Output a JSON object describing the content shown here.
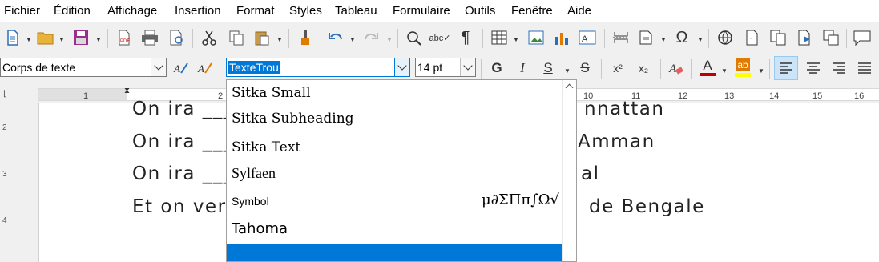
{
  "menu": [
    "Fichier",
    "Édition",
    "Affichage",
    "Insertion",
    "Format",
    "Styles",
    "Tableau",
    "Formulaire",
    "Outils",
    "Fenêtre",
    "Aide"
  ],
  "toolbar": {
    "paragraph_style": "Corps de texte",
    "font_name": "TexteTrou",
    "font_size": "14 pt",
    "bold_label": "G",
    "italic_label": "I",
    "underline_label": "S",
    "strike_label": "S",
    "superscript_label": "x²",
    "subscript_label": "x₂",
    "font_color_label": "A",
    "highlight_label": "ab",
    "font_color": "#c00000",
    "highlight_color": "#ffff00"
  },
  "ruler": {
    "numbers": [
      "1",
      "2",
      "10",
      "11",
      "12",
      "13",
      "14",
      "15",
      "16"
    ]
  },
  "vruler": {
    "numbers": [
      "2",
      "3",
      "4"
    ]
  },
  "document": {
    "lines": [
      "On ira",
      "On ira",
      "On ira",
      "Et on ver"
    ],
    "right_fragments": [
      "nnattan",
      "Amman",
      "al",
      "de Bengale"
    ]
  },
  "font_list": {
    "items": [
      "Sitka Small",
      "Sitka Subheading",
      "Sitka Text",
      "Sylfaen",
      "Symbol",
      "Tahoma"
    ],
    "symbol_preview": "μ∂ΣΠπ∫Ω√",
    "selected_color": "#0078d7"
  }
}
